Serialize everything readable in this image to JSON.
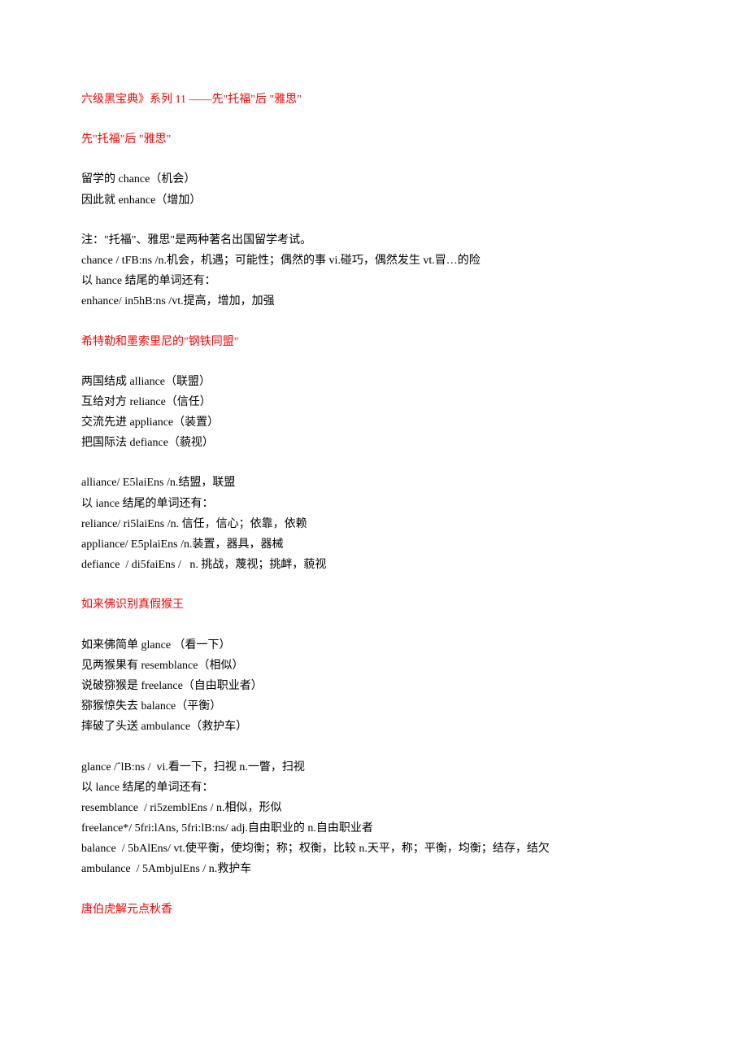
{
  "header": {
    "title_part1": "六级黑宝典》系列 11",
    "title_spacer": "      ",
    "title_part2": "——先\"托福\"后 \"雅思\""
  },
  "sections": [
    {
      "heading": "先\"托福\"后 \"雅思\"",
      "blocks": [
        {
          "lines": [
            "留学的 chance（机会）",
            "因此就 enhance（增加）"
          ]
        },
        {
          "lines": [
            "注：\"托福\"、雅思\"是两种著名出国留学考试。",
            "chance / tFB:ns /n.机会，机遇；可能性；偶然的事 vi.碰巧，偶然发生 vt.冒…的险",
            "以 hance 结尾的单词还有：",
            "enhance/ in5hB:ns /vt.提高，增加，加强"
          ]
        }
      ]
    },
    {
      "heading": "希特勒和墨索里尼的\"钢铁同盟\"",
      "blocks": [
        {
          "lines": [
            "两国结成 alliance（联盟）",
            "互给对方 reliance（信任）",
            "交流先进 appliance（装置）",
            "把国际法 defiance（藐视）"
          ]
        },
        {
          "lines": [
            "alliance/ E5laiEns /n.结盟，联盟",
            "以 iance 结尾的单词还有：",
            "reliance/ ri5laiEns /n. 信任，信心；依靠，依赖",
            "appliance/ E5plaiEns /n.装置，器具，器械",
            "defiance  / di5faiEns /   n. 挑战，蔑视；挑衅，藐视"
          ]
        }
      ]
    },
    {
      "heading": "如来佛识别真假猴王",
      "blocks": [
        {
          "lines": [
            "如来佛简单 glance （看一下）",
            "见两猴果有 resemblance（相似）",
            "说破猕猴是 freelance（自由职业者）",
            "猕猴惊失去 balance（平衡）",
            "摔破了头送 ambulance（救护车）"
          ]
        },
        {
          "lines": [
            "glance /ˆlB:ns /  vi.看一下，扫视 n.一瞥，扫视",
            "以 lance 结尾的单词还有：",
            "resemblance  / ri5zemblEns / n.相似，形似",
            "freelance*/ 5fri:lAns, 5fri:lB:ns/ adj.自由职业的 n.自由职业者",
            "balance  / 5bAlEns/ vt.使平衡，使均衡；称；权衡，比较 n.天平，称；平衡，均衡；结存，结欠",
            "ambulance  / 5AmbjulEns / n.救护车"
          ]
        }
      ]
    },
    {
      "heading": "唐伯虎解元点秋香",
      "blocks": []
    }
  ]
}
